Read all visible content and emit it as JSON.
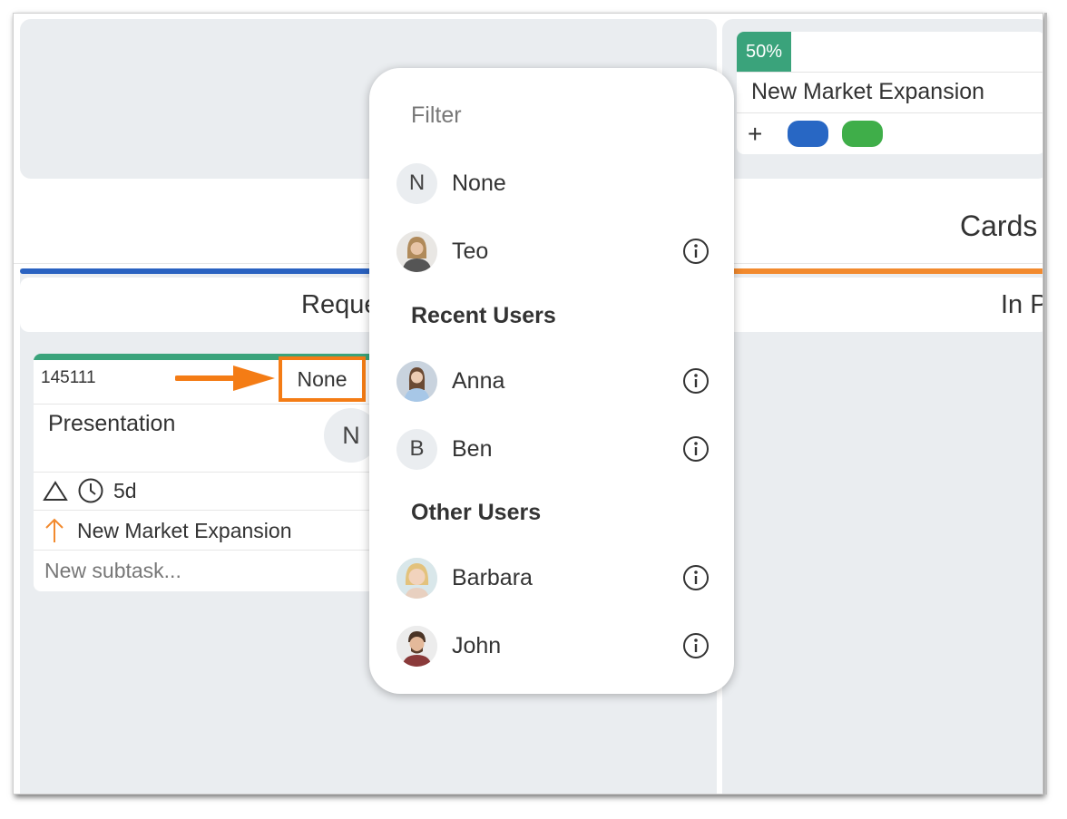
{
  "parent_card": {
    "progress_label": "50%",
    "progress_value": 0.5,
    "title": "New Market Expansion",
    "add_label": "+",
    "tag_colors": [
      "#2867c4",
      "#3fae49"
    ]
  },
  "lanes": {
    "cards_title": "Cards",
    "left": {
      "title": "Reque",
      "bar_color": "#2a62c1"
    },
    "right": {
      "title": "In P",
      "bar_color": "#f28a2e"
    }
  },
  "task_card": {
    "id": "145111",
    "assignee": "None",
    "title": "Presentation",
    "avatar_initial": "N",
    "duration": "5d",
    "parent": "New Market Expansion",
    "subtask_placeholder": "New subtask..."
  },
  "dropdown": {
    "filter_placeholder": "Filter",
    "top_items": [
      {
        "label": "None",
        "initial": "N"
      },
      {
        "label": "Teo"
      }
    ],
    "recent_heading": "Recent Users",
    "recent_users": [
      {
        "label": "Anna"
      },
      {
        "label": "Ben",
        "initial": "B"
      }
    ],
    "other_heading": "Other Users",
    "other_users": [
      {
        "label": "Barbara"
      },
      {
        "label": "John"
      }
    ]
  },
  "colors": {
    "accent_green": "#3aa37b",
    "highlight_orange": "#f47c15",
    "lane_bg": "#eaedf0"
  },
  "icons": [
    "plus-icon",
    "triangle-icon",
    "clock-icon",
    "arrow-up-icon",
    "info-icon",
    "arrow-right-icon"
  ]
}
